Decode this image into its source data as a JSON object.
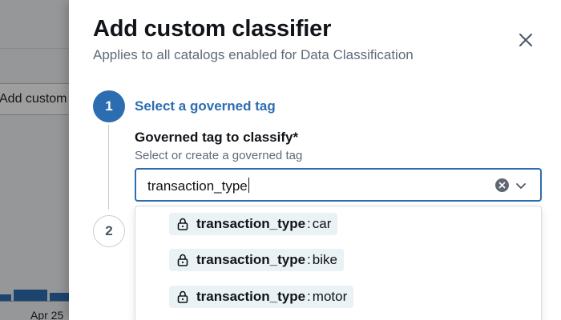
{
  "background": {
    "button_label": "Add custom classifier",
    "axis_date": "Apr 25"
  },
  "drawer": {
    "title": "Add custom classifier",
    "subtitle": "Applies to all catalogs enabled for Data Classification",
    "close_icon": "close-icon"
  },
  "stepper": {
    "step1": {
      "number": "1",
      "label": "Select a governed tag"
    },
    "step2": {
      "number": "2"
    }
  },
  "field": {
    "label": "Governed tag to classify*",
    "hint": "Select or create a governed tag",
    "value": "transaction_type",
    "clear_icon": "clear-icon",
    "dropdown_icon": "chevron-down-icon"
  },
  "options": [
    {
      "key": "transaction_type",
      "sep": ":",
      "value": "car",
      "icon": "lock-icon"
    },
    {
      "key": "transaction_type",
      "sep": ":",
      "value": "bike",
      "icon": "lock-icon"
    },
    {
      "key": "transaction_type",
      "sep": ":",
      "value": "motor",
      "icon": "lock-icon"
    }
  ],
  "colors": {
    "accent": "#2c6db1",
    "option_bg": "#eaf2f6"
  }
}
